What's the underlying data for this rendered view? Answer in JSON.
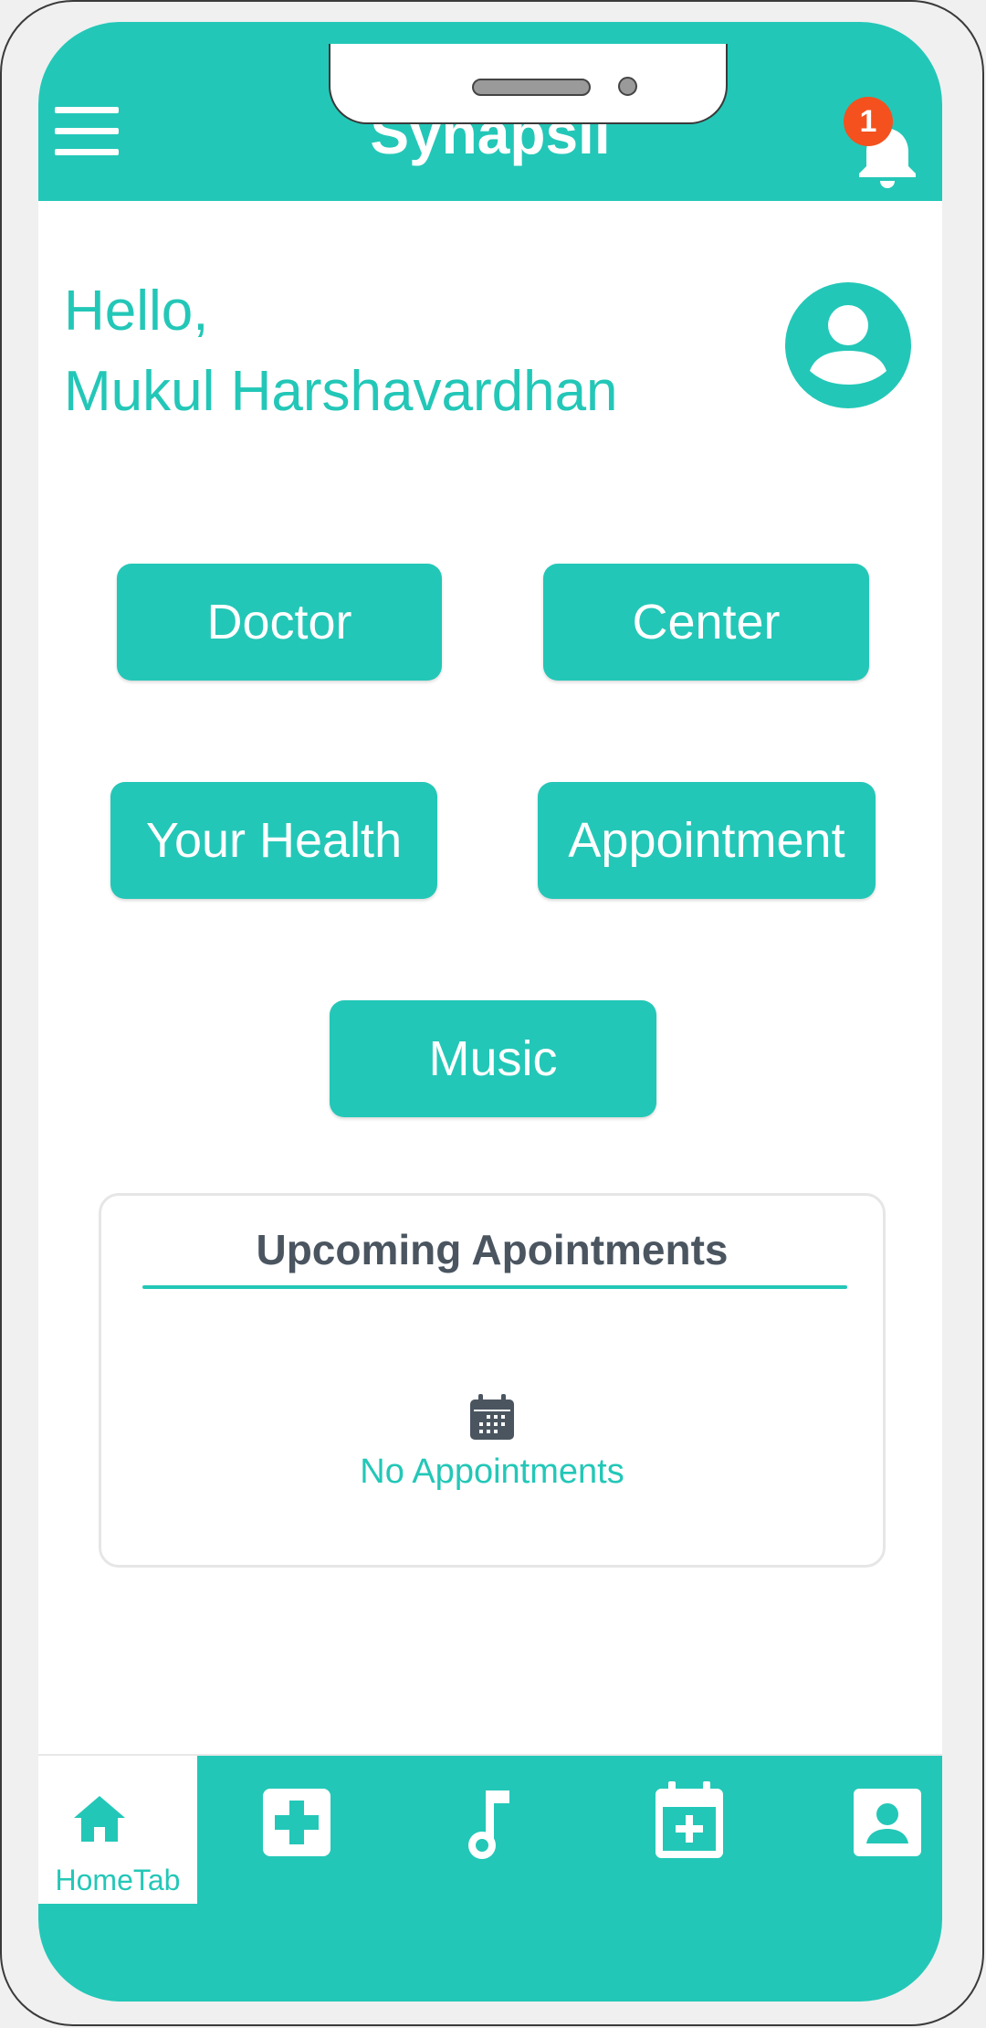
{
  "app": {
    "title": "Synapsil",
    "notification_count": "1",
    "accent_color": "#23c7b7",
    "badge_color": "#f4511e"
  },
  "header": {
    "menu_icon": "hamburger-menu-icon",
    "notification_icon": "bell-icon"
  },
  "greeting": {
    "line1": "Hello,",
    "line2": "Mukul Harshavardhan",
    "avatar_icon": "account-circle-icon"
  },
  "buttons": {
    "doctor": "Doctor",
    "center": "Center",
    "your_health": "Your Health",
    "appointment": "Appointment",
    "music": "Music"
  },
  "upcoming": {
    "title": "Upcoming Apointments",
    "empty_icon": "calendar-icon",
    "empty_text": "No Appointments"
  },
  "bottom_nav": {
    "tabs": [
      {
        "label": "HomeTab",
        "icon": "home-icon",
        "active": true
      },
      {
        "icon": "medical-plus-icon"
      },
      {
        "icon": "music-note-icon"
      },
      {
        "icon": "calendar-plus-icon"
      },
      {
        "icon": "contact-card-icon"
      }
    ]
  }
}
